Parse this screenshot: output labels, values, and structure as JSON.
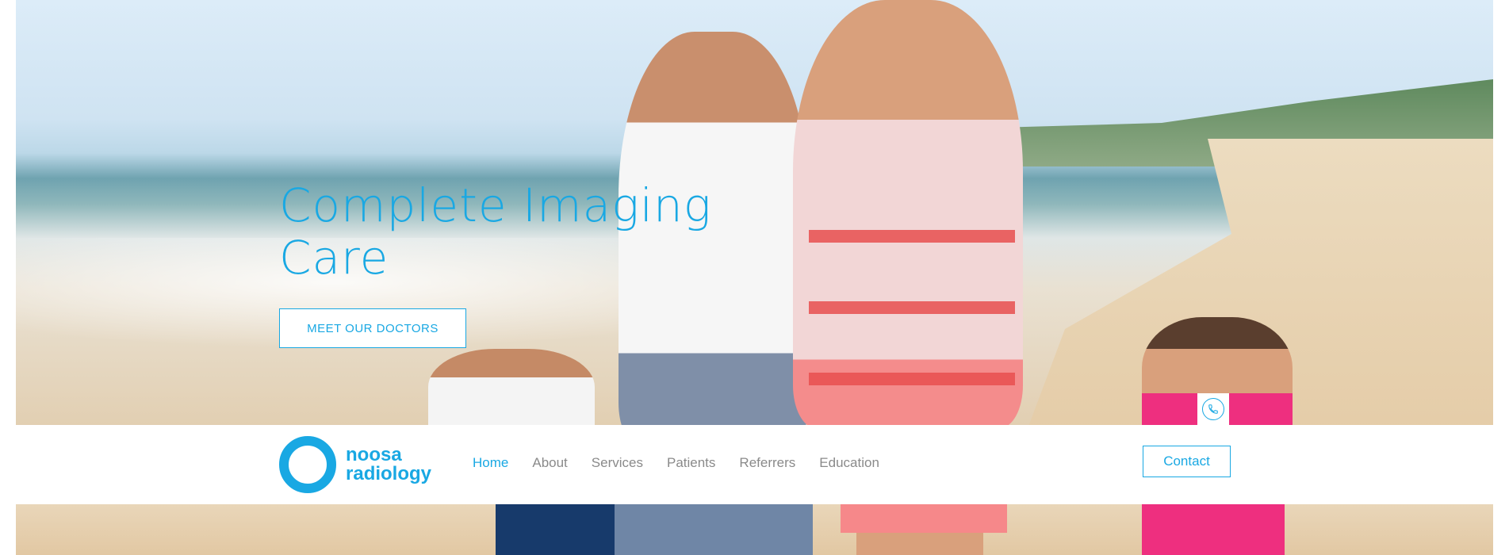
{
  "hero": {
    "title_line1": "Complete Imaging",
    "title_line2": "Care",
    "cta_label": "MEET OUR DOCTORS"
  },
  "logo": {
    "line1": "noosa",
    "line2": "radiology"
  },
  "nav": {
    "items": [
      "Home",
      "About",
      "Services",
      "Patients",
      "Referrers",
      "Education"
    ],
    "active": "Home",
    "contact_label": "Contact"
  },
  "icons": {
    "phone": "phone-icon"
  },
  "colors": {
    "accent": "#19a8e3",
    "nav_text": "#8a8a8a",
    "background": "#ffffff"
  }
}
